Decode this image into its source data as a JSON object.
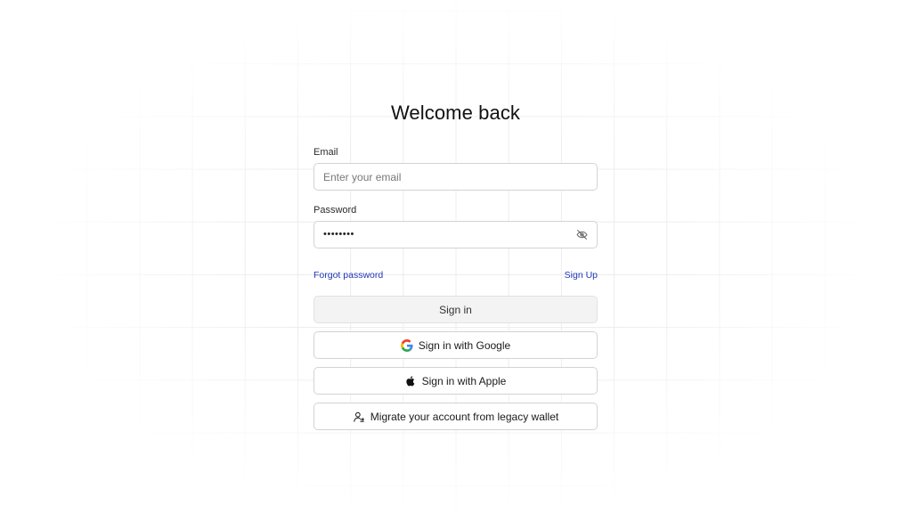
{
  "title": "Welcome back",
  "email": {
    "label": "Email",
    "placeholder": "Enter your email",
    "value": ""
  },
  "password": {
    "label": "Password",
    "masked_value": "••••••••",
    "visibility_icon": "eye-off-icon"
  },
  "links": {
    "forgot": "Forgot password",
    "signup": "Sign Up",
    "color": "#1f35b8"
  },
  "buttons": {
    "sign_in": "Sign in",
    "google": {
      "label": "Sign in with Google",
      "icon": "google-icon"
    },
    "apple": {
      "label": "Sign in with Apple",
      "icon": "apple-icon"
    },
    "migrate": {
      "label": "Migrate your account from legacy wallet",
      "icon": "user-migrate-icon"
    }
  }
}
